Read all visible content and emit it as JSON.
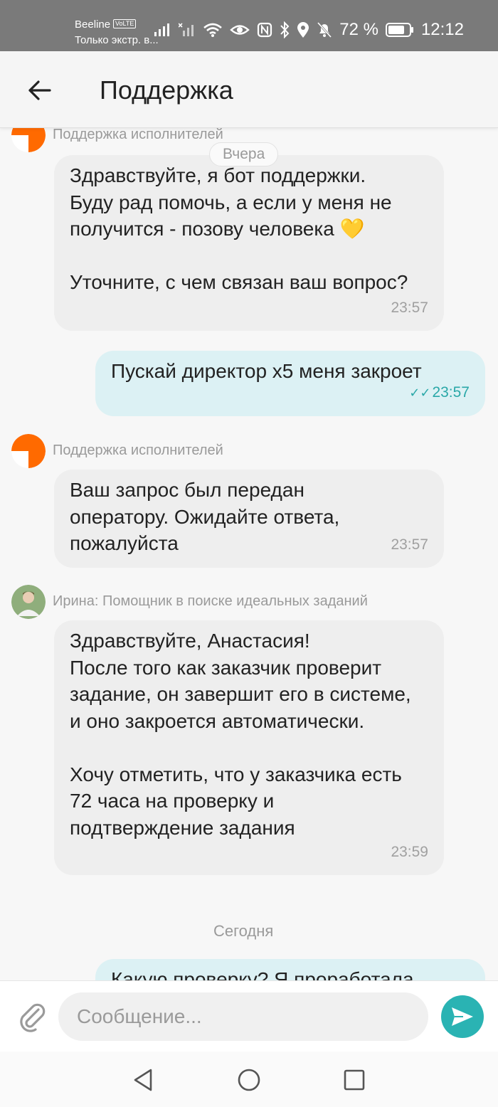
{
  "status_bar": {
    "carrier": "Beeline",
    "volte": "VoLTE",
    "carrier_sub": "Только экстр. в...",
    "battery": "72 %",
    "time": "12:12"
  },
  "header": {
    "title": "Поддержка"
  },
  "chat": {
    "date_yesterday": "Вчера",
    "date_today": "Сегодня",
    "messages": [
      {
        "sender": "Поддержка исполнителей",
        "text": "Здравствуйте, я бот поддержки.\nБуду рад помочь, а если у меня не получится - позову человека 💛\n\nУточните, с чем связан ваш вопрос?",
        "time": "23:57"
      },
      {
        "text": "Пускай директор х5 меня закроет",
        "status": "✓✓",
        "time": "23:57"
      },
      {
        "sender": "Поддержка исполнителей",
        "text": "Ваш запрос был передан оператору. Ожидайте ответа, пожалуйста",
        "time": "23:57"
      },
      {
        "sender": "Ирина: Помощник в поиске идеальных заданий",
        "text": "Здравствуйте, Анастасия!\nПосле того как заказчик проверит задание, он завершит его в системе, и оно закроется автоматически.\n\nХочу отметить, что у заказчика есть 72 часа на проверку и подтверждение задания",
        "time": "23:59"
      },
      {
        "text": "Какую проверку? Я проработала"
      }
    ]
  },
  "composer": {
    "placeholder": "Сообщение..."
  },
  "colors": {
    "accent": "#2ab3b3",
    "outgoing_bubble": "#dcf1f4",
    "incoming_bubble": "#eeeeee",
    "brand_orange": "#ff6a00"
  }
}
